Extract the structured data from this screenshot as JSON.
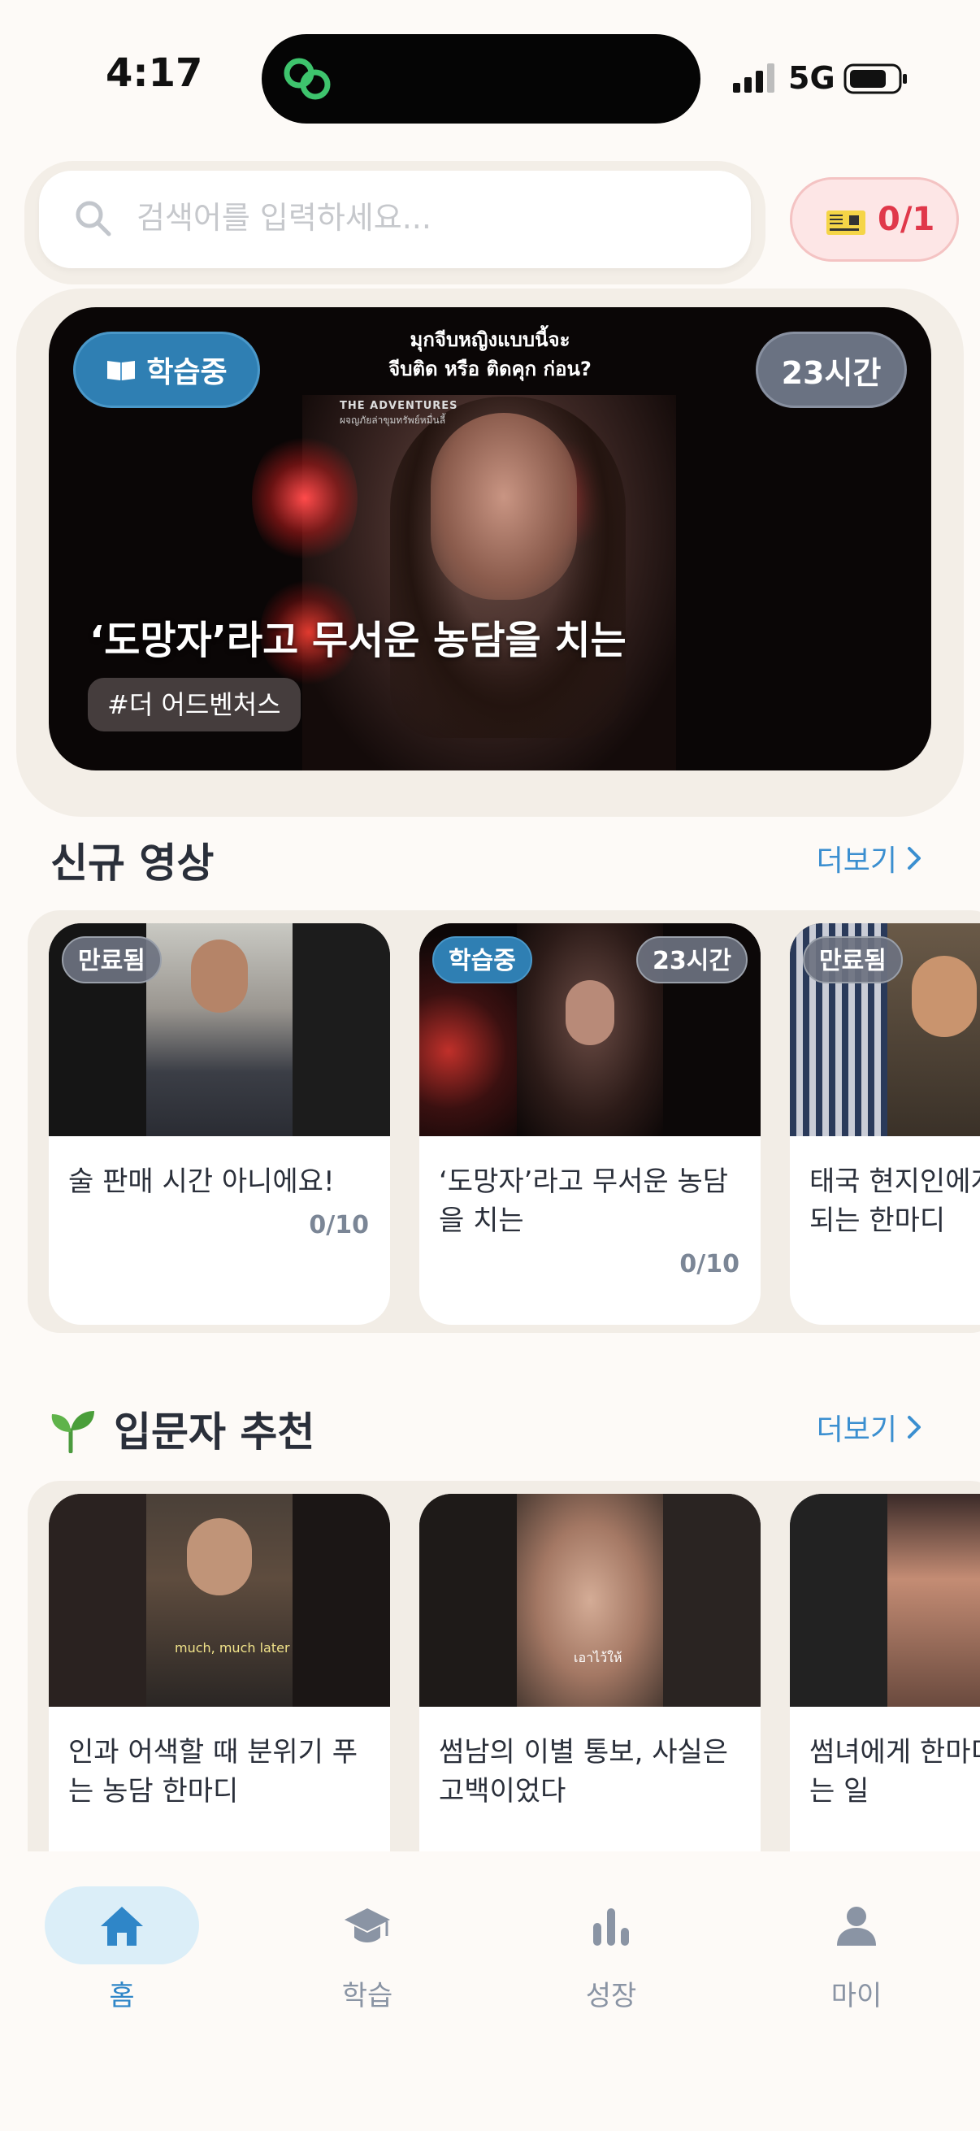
{
  "status_bar": {
    "time": "4:17",
    "network": "5G"
  },
  "search": {
    "placeholder": "검색어를 입력하세요..."
  },
  "ticket": {
    "count": "0/1"
  },
  "hero": {
    "badge": "학습중",
    "time_left": "23시간",
    "subtitle_line1": "มุกจีบหญิงแบบนี้จะ",
    "subtitle_line2": "จีบติด หรือ ติดคุก ก่อน?",
    "logo_line1": "THE ADVENTURES",
    "logo_line2": "ผจญภัยล่าขุมทรัพย์หมื่นลี้",
    "title": "‘도망자’라고 무서운 농담을 치는",
    "tag": "#더 어드벤처스"
  },
  "new_videos": {
    "title": "신규 영상",
    "more": "더보기",
    "cards": [
      {
        "status": "만료됨",
        "title": "술 판매 시간 아니에요!",
        "progress": "0/10"
      },
      {
        "status": "학습중",
        "time_left": "23시간",
        "title": "‘도망자’라고 무서운 농담을 치는",
        "progress": "0/10"
      },
      {
        "status": "만료됨",
        "title": "태국 현지인에게 하면 안 되는 한마디"
      }
    ]
  },
  "beginner": {
    "title": "입문자 추천",
    "more": "더보기",
    "cards": [
      {
        "title": "인과 어색할 때 분위기 푸는 농담 한마디",
        "caption": "much, much later"
      },
      {
        "title": " 썸남의 이별 통보, 사실은 고백이었다",
        "caption": "เอาไว้ให้"
      },
      {
        "title": " 썸녀에게 한마디 하면 생기는 일"
      }
    ]
  },
  "tabs": [
    {
      "label": "홈",
      "icon": "home-icon",
      "active": true
    },
    {
      "label": "학습",
      "icon": "graduation-cap-icon",
      "active": false
    },
    {
      "label": "성장",
      "icon": "bar-chart-icon",
      "active": false
    },
    {
      "label": "마이",
      "icon": "user-icon",
      "active": false
    }
  ],
  "colors": {
    "accent": "#3b8fd0",
    "study_badge": "#2f7fb3",
    "ticket_text": "#e0384a",
    "background": "#fdfaf7"
  }
}
